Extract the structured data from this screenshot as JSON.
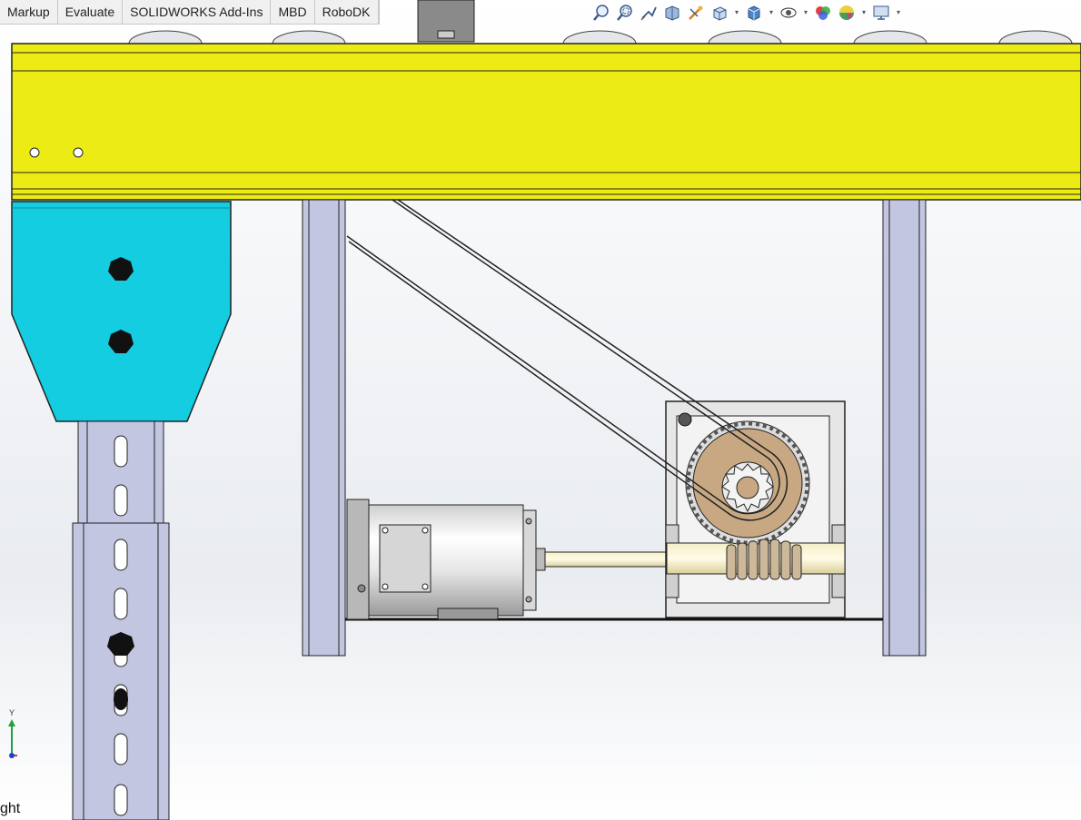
{
  "command_manager": {
    "tabs": [
      {
        "label": "Markup"
      },
      {
        "label": "Evaluate"
      },
      {
        "label": "SOLIDWORKS Add-Ins"
      },
      {
        "label": "MBD"
      },
      {
        "label": "RoboDK"
      }
    ]
  },
  "heads_up_toolbar": {
    "buttons": [
      {
        "icon": "zoom-to-fit-icon"
      },
      {
        "icon": "zoom-to-area-icon"
      },
      {
        "icon": "previous-view-icon"
      },
      {
        "icon": "section-view-icon"
      },
      {
        "icon": "dynamic-annotation-icon"
      },
      {
        "icon": "view-orientation-icon",
        "dropdown": true
      },
      {
        "icon": "display-style-icon",
        "dropdown": true
      },
      {
        "icon": "hide-show-items-icon",
        "dropdown": true
      },
      {
        "icon": "edit-appearance-icon",
        "dropdown": true
      },
      {
        "icon": "view-settings-icon",
        "dropdown": true
      }
    ]
  },
  "viewport": {
    "view_label": "ght",
    "triad_axis_label": "Y"
  },
  "colors": {
    "conveyor_frame": "#ecec14",
    "mount_bracket": "#14cde0",
    "leg": "#c3c6e0",
    "worm_gear": "#c8a882",
    "gearbox": "#e6e6e6"
  }
}
